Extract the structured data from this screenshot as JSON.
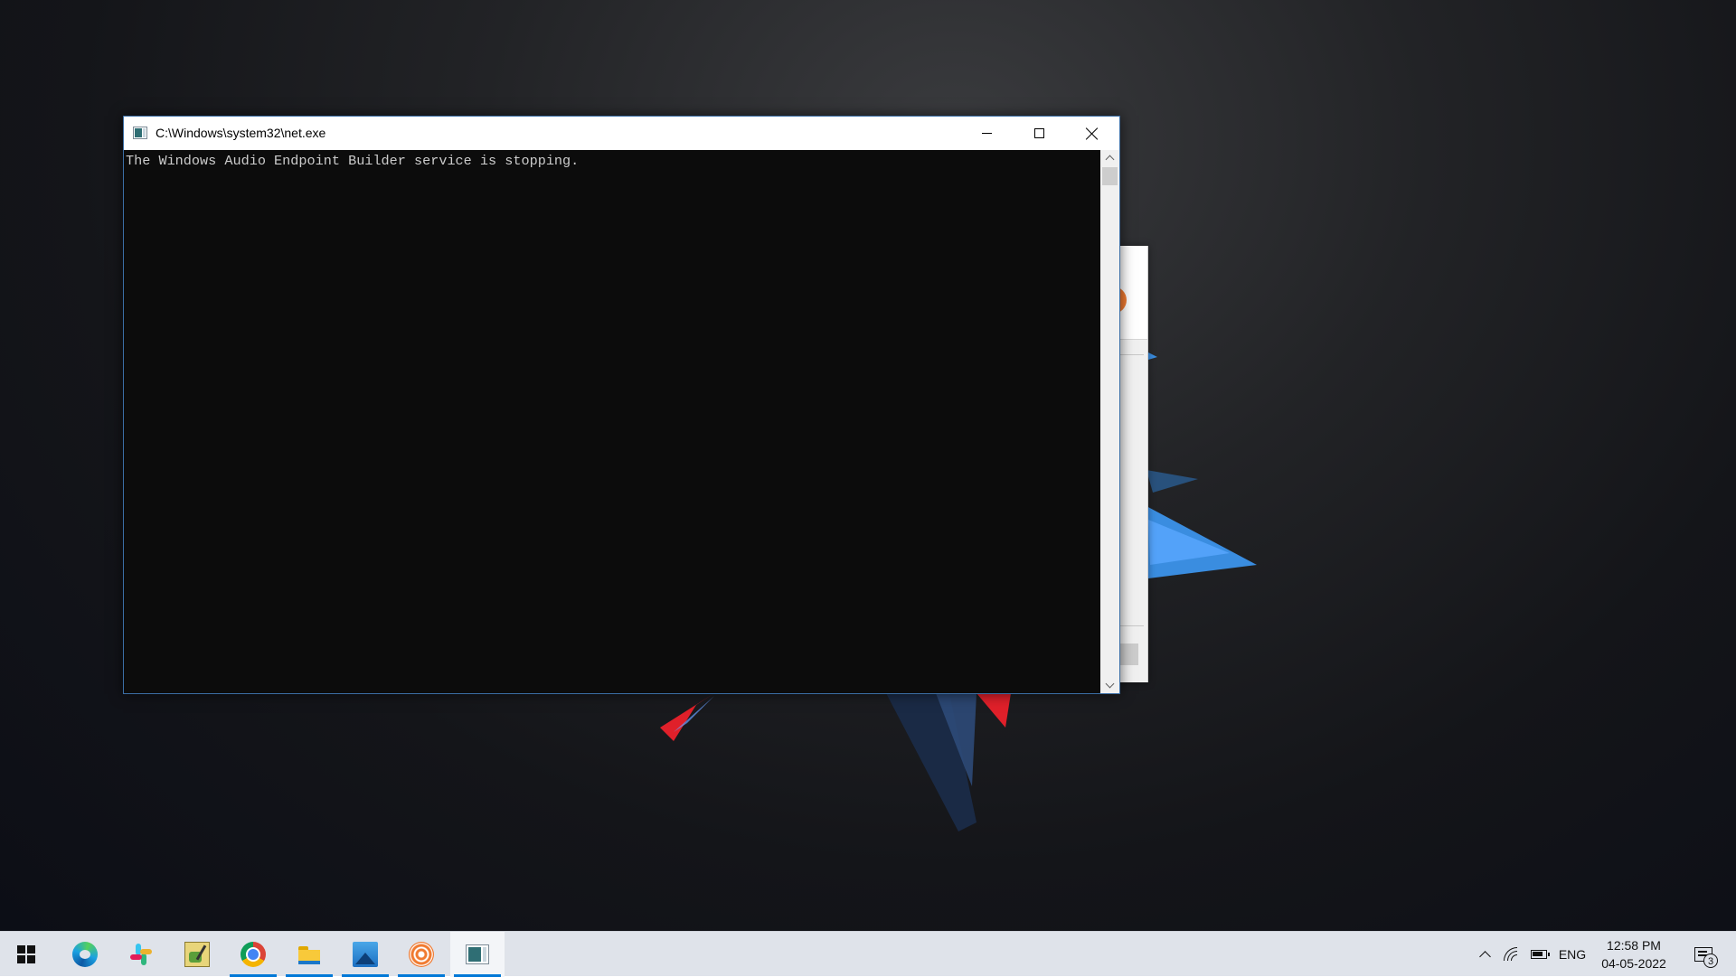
{
  "console": {
    "title": "C:\\Windows\\system32\\net.exe",
    "output": "The Windows Audio Endpoint Builder service is stopping."
  },
  "taskbar": {
    "items": [
      {
        "name": "start-button",
        "icon": "windows-logo-icon"
      },
      {
        "name": "edge",
        "icon": "edge-icon",
        "running": false
      },
      {
        "name": "slack",
        "icon": "slack-icon",
        "running": false
      },
      {
        "name": "notes-app",
        "icon": "notes-icon",
        "running": false
      },
      {
        "name": "chrome",
        "icon": "chrome-icon",
        "running": true
      },
      {
        "name": "file-explorer",
        "icon": "folder-icon",
        "running": true
      },
      {
        "name": "photos",
        "icon": "photos-icon",
        "running": true
      },
      {
        "name": "orange-spiral-app",
        "icon": "spiral-icon",
        "running": true
      },
      {
        "name": "command-console",
        "icon": "console-icon",
        "running": true,
        "active": true
      }
    ],
    "tray": {
      "language": "ENG",
      "time": "12:58 PM",
      "date": "04-05-2022",
      "notification_count": "3"
    }
  },
  "colors": {
    "console_bg": "#0c0c0c",
    "console_text": "#cccccc",
    "taskbar_bg": "#dfe3ea",
    "accent": "#0078d7"
  }
}
